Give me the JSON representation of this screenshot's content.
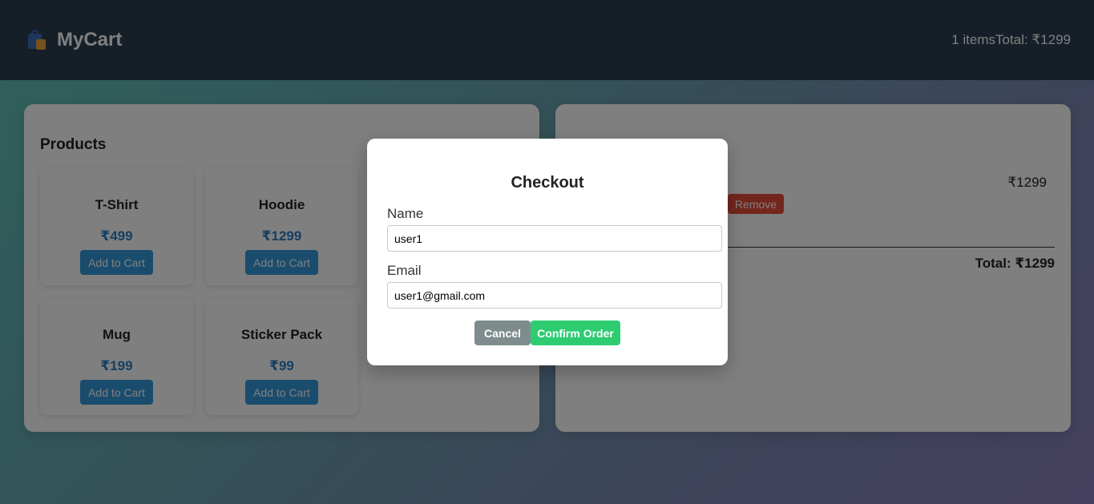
{
  "header": {
    "brand_icon": "shopping-bags-icon",
    "title": "MyCart",
    "summary": "1 itemsTotal: ₹1299"
  },
  "products": {
    "title": "Products",
    "items": [
      {
        "name": "T-Shirt",
        "price": "₹499",
        "button": "Add to Cart"
      },
      {
        "name": "Hoodie",
        "price": "₹1299",
        "button": "Add to Cart"
      },
      {
        "name": "Mug",
        "price": "₹199",
        "button": "Add to Cart"
      },
      {
        "name": "Sticker Pack",
        "price": "₹99",
        "button": "Add to Cart"
      }
    ]
  },
  "cart": {
    "item_price": "₹1299",
    "remove_label": "Remove",
    "total": "Total: ₹1299"
  },
  "checkout": {
    "title": "Checkout",
    "name_label": "Name",
    "name_value": "user1",
    "email_label": "Email",
    "email_value": "user1@gmail.com",
    "cancel_label": "Cancel",
    "confirm_label": "Confirm Order"
  },
  "colors": {
    "header_bg": "#2c3e50",
    "primary": "#3498db",
    "danger": "#e74c3c",
    "success": "#2ecc71",
    "muted": "#7f8c8d"
  }
}
